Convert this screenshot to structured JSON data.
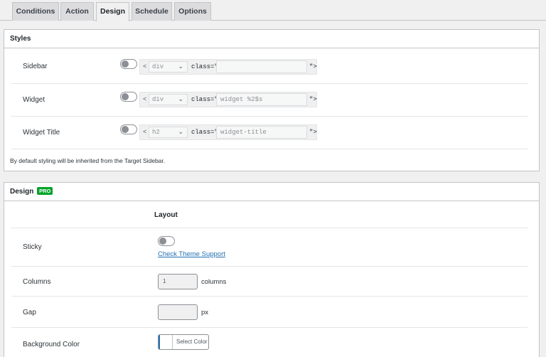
{
  "tabs": [
    {
      "label": "Conditions",
      "active": false
    },
    {
      "label": "Action",
      "active": false
    },
    {
      "label": "Design",
      "active": true
    },
    {
      "label": "Schedule",
      "active": false
    },
    {
      "label": "Options",
      "active": false
    }
  ],
  "styles": {
    "title": "Styles",
    "rows": [
      {
        "label": "Sidebar",
        "enabled": false,
        "tag": "div",
        "class_prefix": "class=\"",
        "class_value": "",
        "suffix": "\">"
      },
      {
        "label": "Widget",
        "enabled": false,
        "tag": "div",
        "class_prefix": "class=\"",
        "class_value": "widget %2$s",
        "suffix": "\">"
      },
      {
        "label": "Widget Title",
        "enabled": false,
        "tag": "h2",
        "class_prefix": "class=\"",
        "class_value": "widget-title",
        "suffix": "\">"
      }
    ],
    "lt": "<",
    "note": "By default styling will be inherited from the Target Sidebar."
  },
  "design": {
    "title": "Design",
    "badge": "PRO",
    "layout_heading": "Layout",
    "sticky": {
      "label": "Sticky",
      "enabled": false,
      "link": "Check Theme Support"
    },
    "columns": {
      "label": "Columns",
      "value": "1",
      "unit": "columns"
    },
    "gap": {
      "label": "Gap",
      "value": "",
      "unit": "px"
    },
    "background": {
      "label": "Background Color",
      "button": "Select Color"
    }
  },
  "colors": {
    "accent": "#2271b1",
    "pro_badge": "#00a32a",
    "border": "#c3c4c7"
  }
}
